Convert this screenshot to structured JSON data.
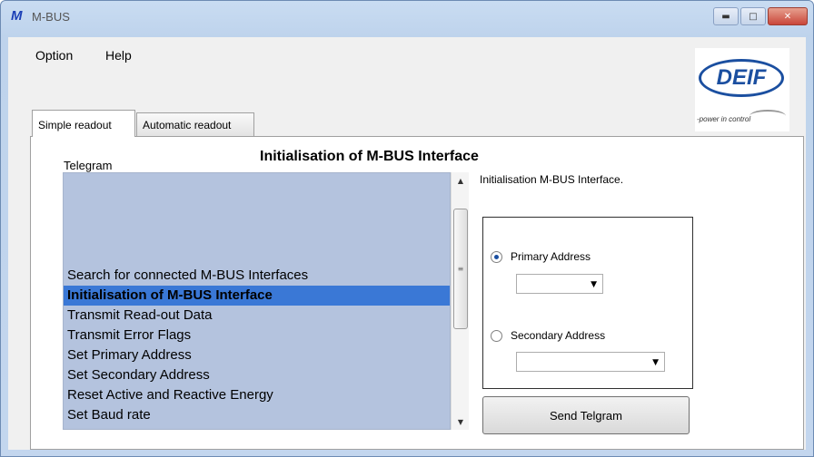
{
  "window": {
    "app_icon": "M",
    "title": "M-BUS",
    "buttons": {
      "minimize": "▬",
      "maximize": "□",
      "close": "✕"
    }
  },
  "menu": {
    "items": [
      "Option",
      "Help"
    ]
  },
  "logo": {
    "text": "DEIF",
    "tagline": "-power in control"
  },
  "tabs": [
    {
      "label": "Simple readout",
      "active": true
    },
    {
      "label": "Automatic readout",
      "active": false
    }
  ],
  "telegram": {
    "label": "Telegram",
    "heading": "Initialisation of M-BUS Interface",
    "items": [
      "Search for connected M-BUS Interfaces",
      "Initialisation of M-BUS Interface",
      "Transmit Read-out Data",
      "Transmit Error Flags",
      "Set Primary Address",
      "Set Secondary Address",
      "Reset Active and Reactive Energy",
      "Set Baud rate"
    ],
    "selected_index": 1
  },
  "description": "Initialisation M-BUS Interface.",
  "address": {
    "primary_label": "Primary Address",
    "secondary_label": "Secondary Address",
    "primary_checked": true,
    "primary_value": "",
    "secondary_value": ""
  },
  "send_button": "Send Telgram",
  "colors": {
    "list_bg": "#b4c3de",
    "selected_bg": "#3a78d6",
    "titlebar": "#c9dcf2"
  }
}
